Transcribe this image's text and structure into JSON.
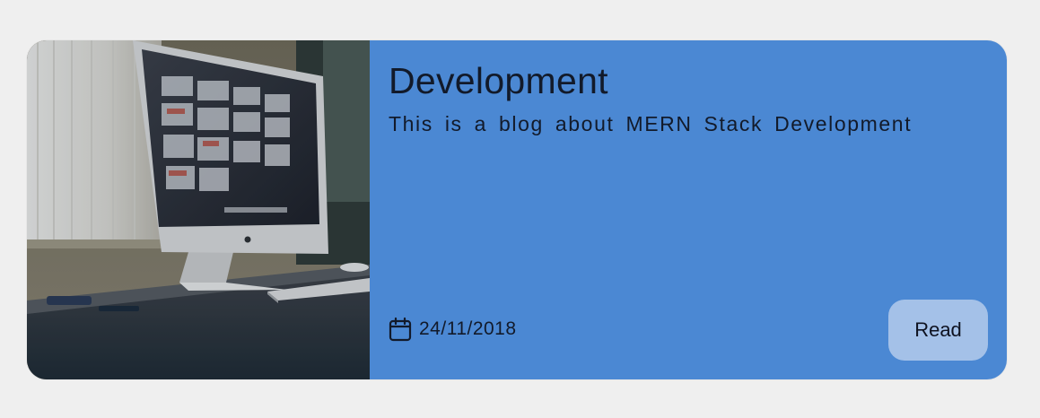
{
  "card": {
    "image_alt": "desk with computer monitor",
    "title": "Development",
    "description": "This is a blog about MERN Stack Development",
    "date": "24/11/2018",
    "read_label": "Read"
  },
  "colors": {
    "page_background": "#efefef",
    "card_background": "#4b88d3",
    "button_background": "#a4c1e8",
    "text": "#121a2a"
  },
  "icons": {
    "date_icon": "calendar-icon"
  }
}
